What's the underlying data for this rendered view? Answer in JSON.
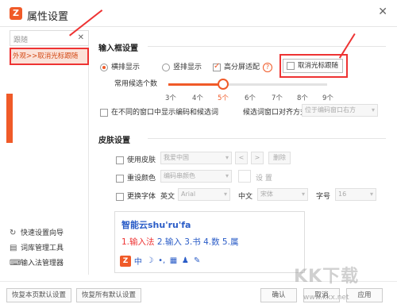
{
  "window": {
    "title": "属性设置",
    "logo": "Z",
    "close": "✕"
  },
  "sidebar": {
    "search_value": "跟随",
    "search_clear": "✕",
    "result": "外观>>取消光标跟随",
    "links": [
      {
        "icon": "refresh-icon",
        "glyph": "↻",
        "label": "快速设置向导"
      },
      {
        "icon": "book-icon",
        "glyph": "▤",
        "label": "词库管理工具"
      },
      {
        "icon": "keyboard-icon",
        "glyph": "⌨",
        "label": "输入法管理器"
      }
    ]
  },
  "input_box": {
    "section_title": "输入框设置",
    "horizontal": "横排显示",
    "vertical": "竖排显示",
    "hidpi": "高分屏适配",
    "help": "?",
    "cancel_follow": "取消光标跟随",
    "candidate_count_label": "常用候选个数",
    "candidate_ticks": [
      "3个",
      "4个",
      "5个",
      "6个",
      "7个",
      "8个",
      "9个"
    ],
    "candidate_selected": "5个",
    "separate_window": "在不同的窗口中显示编码和候选词",
    "align_label": "候选词窗口对齐方式",
    "align_value": "位于编码窗口右方"
  },
  "skin": {
    "section_title": "皮肤设置",
    "use_skin": "使用皮肤",
    "skin_value": "我爱中国",
    "prev": "<",
    "next": ">",
    "delete": "删除",
    "reset_color": "重设颜色",
    "color_value": "编码串颜色",
    "settings": "设 置",
    "change_font": "更换字体",
    "english_label": "英文",
    "english_font": "Arial",
    "chinese_label": "中文",
    "chinese_font": "宋体",
    "size_label": "字号",
    "size_value": "16"
  },
  "preview": {
    "input_text": "智能云shu'ru'fa",
    "candidates_first": "1.输入法",
    "candidates_rest": " 2.输入 3.书 4.数 5.属",
    "status_logo": "Z",
    "status_icons": [
      "中",
      "☽",
      "•,",
      "▦",
      "♟",
      "✎"
    ]
  },
  "bottom": {
    "restore_page": "恢复本页默认设置",
    "restore_all": "恢复所有默认设置",
    "ok": "确认",
    "cancel": "取消",
    "apply": "应用"
  },
  "watermark": {
    "text": "KK下载",
    "url": "www.kkx.net"
  },
  "colors": {
    "accent": "#f05a28",
    "highlight": "#e33333",
    "preview_blue": "#2a5cc7"
  }
}
